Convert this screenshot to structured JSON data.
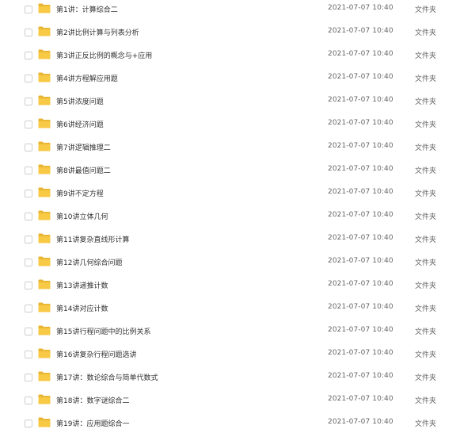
{
  "colors": {
    "folder_fill": "#f7c945",
    "folder_tab": "#e9b431",
    "text": "#333333",
    "muted_text": "#666666"
  },
  "files": [
    {
      "name": "第1讲：计算综合二",
      "modified": "2021-07-07 10:40",
      "type": "文件夹",
      "icon": "folder-icon"
    },
    {
      "name": "第2讲比例计算与列表分析",
      "modified": "2021-07-07 10:40",
      "type": "文件夹",
      "icon": "folder-icon"
    },
    {
      "name": "第3讲正反比例的概念与+应用",
      "modified": "2021-07-07 10:40",
      "type": "文件夹",
      "icon": "folder-icon"
    },
    {
      "name": "第4讲方程解应用题",
      "modified": "2021-07-07 10:40",
      "type": "文件夹",
      "icon": "folder-icon"
    },
    {
      "name": "第5讲浓度问题",
      "modified": "2021-07-07 10:40",
      "type": "文件夹",
      "icon": "folder-icon"
    },
    {
      "name": "第6讲经济问题",
      "modified": "2021-07-07 10:40",
      "type": "文件夹",
      "icon": "folder-icon"
    },
    {
      "name": "第7讲逻辑推理二",
      "modified": "2021-07-07 10:40",
      "type": "文件夹",
      "icon": "folder-icon"
    },
    {
      "name": "第8讲最值问题二",
      "modified": "2021-07-07 10:40",
      "type": "文件夹",
      "icon": "folder-icon"
    },
    {
      "name": "第9讲不定方程",
      "modified": "2021-07-07 10:40",
      "type": "文件夹",
      "icon": "folder-icon"
    },
    {
      "name": "第10讲立体几何",
      "modified": "2021-07-07 10:40",
      "type": "文件夹",
      "icon": "folder-icon"
    },
    {
      "name": "第11讲复杂直线形计算",
      "modified": "2021-07-07 10:40",
      "type": "文件夹",
      "icon": "folder-icon"
    },
    {
      "name": "第12讲几何综合问题",
      "modified": "2021-07-07 10:40",
      "type": "文件夹",
      "icon": "folder-icon"
    },
    {
      "name": "第13讲递推计数",
      "modified": "2021-07-07 10:40",
      "type": "文件夹",
      "icon": "folder-icon"
    },
    {
      "name": "第14讲对应计数",
      "modified": "2021-07-07 10:40",
      "type": "文件夹",
      "icon": "folder-icon"
    },
    {
      "name": "第15讲行程问题中的比例关系",
      "modified": "2021-07-07 10:40",
      "type": "文件夹",
      "icon": "folder-icon"
    },
    {
      "name": "第16讲复杂行程问题选讲",
      "modified": "2021-07-07 10:40",
      "type": "文件夹",
      "icon": "folder-icon"
    },
    {
      "name": "第17讲：数论综合与简单代数式",
      "modified": "2021-07-07 10:40",
      "type": "文件夹",
      "icon": "folder-icon"
    },
    {
      "name": "第18讲：数字谜综合二",
      "modified": "2021-07-07 10:40",
      "type": "文件夹",
      "icon": "folder-icon"
    },
    {
      "name": "第19讲：应用题综合一",
      "modified": "2021-07-07 10:40",
      "type": "文件夹",
      "icon": "folder-icon"
    }
  ]
}
